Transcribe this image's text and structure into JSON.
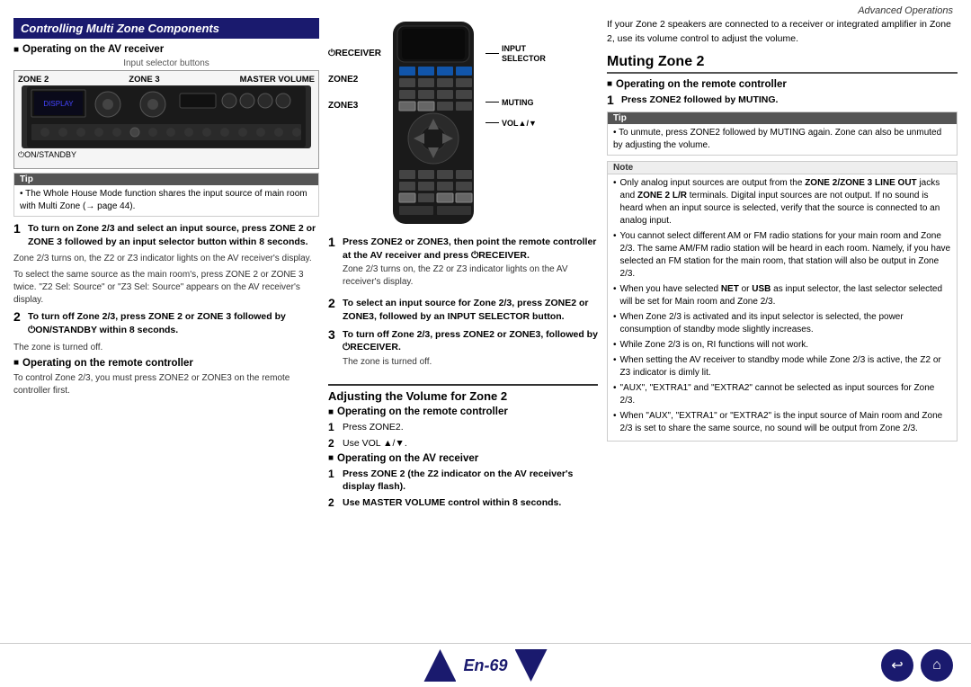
{
  "page": {
    "header": "Advanced Operations",
    "footer": {
      "page_number": "En-69",
      "prev_arrow": "▲",
      "next_arrow": "▼",
      "back_icon": "↩",
      "home_icon": "⌂"
    }
  },
  "left_col": {
    "section_title": "Controlling Multi Zone Components",
    "sub1_heading": "Operating on the AV receiver",
    "input_selector_label": "Input selector buttons",
    "zone_labels": {
      "zone2": "ZONE 2",
      "zone3": "ZONE 3",
      "master": "MASTER VOLUME"
    },
    "standby_label": "⏻ON/STANDBY",
    "tip": {
      "header": "Tip",
      "content": "• The Whole House Mode function shares the input source of main room with Multi Zone (→ page 44)."
    },
    "step1": {
      "num": "1",
      "bold_text": "To turn on Zone 2/3 and select an input source, press ZONE 2 or ZONE 3 followed by an input selector button within 8 seconds.",
      "note1": "Zone 2/3 turns on, the Z2 or Z3 indicator lights on the AV receiver's display.",
      "note2": "To select the same source as the main room's, press ZONE 2 or ZONE 3 twice. \"Z2 Sel: Source\" or \"Z3 Sel: Source\" appears on the AV receiver's display."
    },
    "step2": {
      "num": "2",
      "bold_text": "To turn off Zone 2/3, press ZONE 2 or ZONE 3 followed by ⏻ON/STANDBY within 8 seconds.",
      "note": "The zone is turned off."
    },
    "sub2_heading": "Operating on the remote controller",
    "remote_note": "To control Zone 2/3, you must press ZONE2 or ZONE3 on the remote controller first."
  },
  "mid_col": {
    "remote": {
      "receiver_label": "⏻RECEIVER",
      "input_selector": "INPUT\nSELECTOR",
      "zone2_label": "ZONE2",
      "zone3_label": "ZONE3",
      "muting_label": "MUTING",
      "vol_label": "VOL▲/▼"
    },
    "step1": {
      "num": "1",
      "text": "Press ZONE2 or ZONE3, then point the remote controller at the AV receiver and press ⏻RECEIVER.",
      "note": "Zone 2/3 turns on, the Z2 or Z3 indicator lights on the AV receiver's display."
    },
    "step2": {
      "num": "2",
      "bold_text": "To select an input source for Zone 2/3, press ZONE2 or ZONE3, followed by an INPUT SELECTOR button."
    },
    "step3": {
      "num": "3",
      "bold_text": "To turn off Zone 2/3, press ZONE2 or ZONE3, followed by ⏻RECEIVER.",
      "note": "The zone is turned off."
    },
    "adjusting_section": {
      "title": "Adjusting the Volume for Zone 2",
      "sub_heading": "Operating on the remote controller",
      "step1": {
        "num": "1",
        "text": "Press ZONE2."
      },
      "step2": {
        "num": "2",
        "text": "Use VOL ▲/▼."
      },
      "sub2_heading": "Operating on the AV receiver",
      "av_step1": {
        "num": "1",
        "bold_text": "Press ZONE 2 (the Z2 indicator on the AV receiver's display flash)."
      },
      "av_step2": {
        "num": "2",
        "bold_text": "Use MASTER VOLUME control within 8 seconds."
      }
    }
  },
  "right_col": {
    "top_text": "If your Zone 2 speakers are connected to a receiver or integrated amplifier in Zone 2, use its volume control to adjust the volume.",
    "muting_zone_title": "Muting Zone 2",
    "sub_heading": "Operating on the remote controller",
    "step1": {
      "num": "1",
      "text": "Press ZONE2 followed by MUTING."
    },
    "tip": {
      "header": "Tip",
      "content": "• To unmute, press ZONE2 followed by MUTING again. Zone can also be unmuted by adjusting the volume."
    },
    "note": {
      "header": "Note",
      "bullets": [
        "Only analog input sources are output from the ZONE 2/ZONE 3 LINE OUT jacks and ZONE 2 L/R terminals. Digital input sources are not output. If no sound is heard when an input source is selected, verify that the source is connected to an analog input.",
        "You cannot select different AM or FM radio stations for your main room and Zone 2/3. The same AM/FM radio station will be heard in each room. Namely, if you have selected an FM station for the main room, that station will also be output in Zone 2/3.",
        "When you have selected NET or USB as input selector, the last selector selected will be set for Main room and Zone 2/3.",
        "When Zone 2/3 is activated and its input selector is selected, the power consumption of standby mode slightly increases.",
        "While Zone 2/3 is on, RI functions will not work.",
        "When setting the AV receiver to standby mode while Zone 2/3 is active, the Z2 or Z3 indicator is dimly lit.",
        "\"AUX\", \"EXTRA1\" and \"EXTRA2\" cannot be selected as input sources for Zone 2/3.",
        "When \"AUX\", \"EXTRA1\" or \"EXTRA2\" is the input source of Main room and Zone 2/3 is set to share the same source, no sound will be output from Zone 2/3."
      ]
    }
  }
}
